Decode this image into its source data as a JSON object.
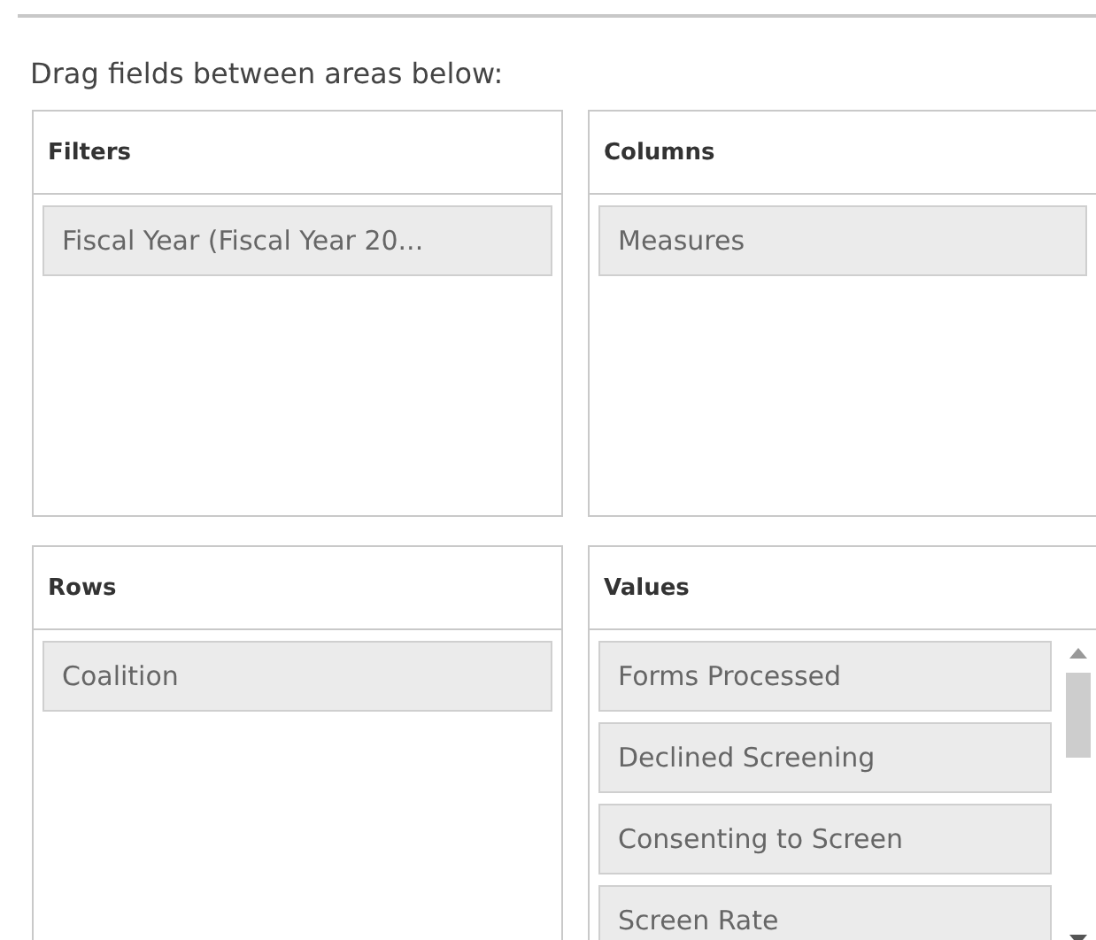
{
  "instruction": "Drag fields between areas below:",
  "areas": [
    {
      "title": "Filters",
      "scrollable": false,
      "fields": [
        "Fiscal Year (Fiscal Year 20..."
      ]
    },
    {
      "title": "Columns",
      "scrollable": false,
      "fields": [
        "Measures"
      ]
    },
    {
      "title": "Rows",
      "scrollable": false,
      "fields": [
        "Coalition"
      ]
    },
    {
      "title": "Values",
      "scrollable": true,
      "fields": [
        "Forms Processed",
        "Declined Screening",
        "Consenting to Screen",
        "Screen Rate"
      ]
    }
  ]
}
